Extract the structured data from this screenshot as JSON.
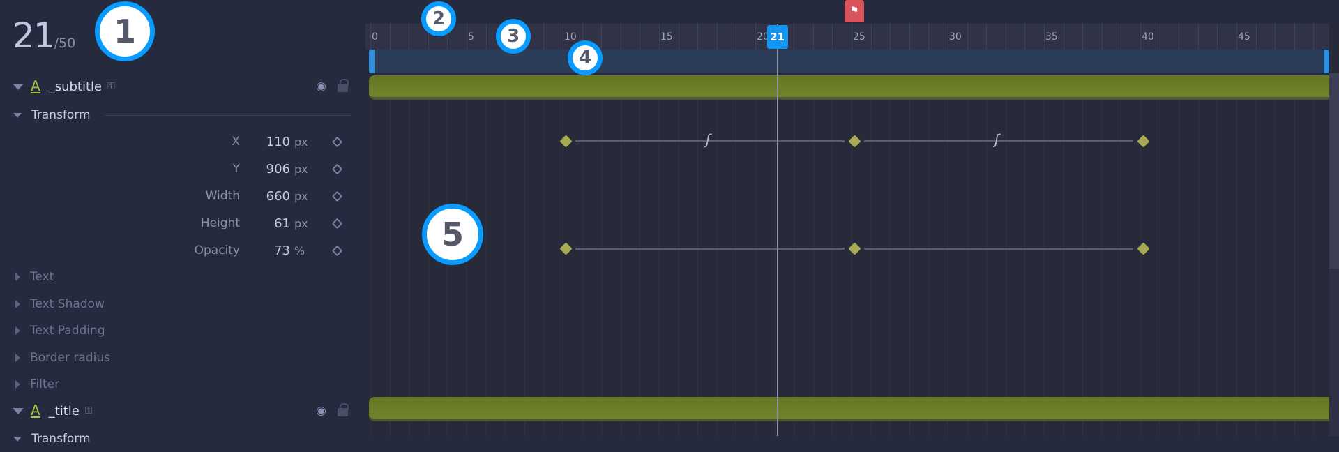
{
  "frame": {
    "current": "21",
    "total": "/50"
  },
  "layers": [
    {
      "name": "_subtitle",
      "icon": "text-layer-icon"
    },
    {
      "name": "_title",
      "icon": "text-layer-icon"
    }
  ],
  "transform": {
    "label": "Transform",
    "props": [
      {
        "label": "X",
        "value": "110",
        "unit": "px"
      },
      {
        "label": "Y",
        "value": "906",
        "unit": "px"
      },
      {
        "label": "Width",
        "value": "660",
        "unit": "px"
      },
      {
        "label": "Height",
        "value": "61",
        "unit": "px"
      },
      {
        "label": "Opacity",
        "value": "73",
        "unit": "%"
      }
    ]
  },
  "sections": [
    "Text",
    "Text Shadow",
    "Text Padding",
    "Border radius",
    "Filter"
  ],
  "next_section": "Transform",
  "timeline": {
    "total_frames": 50,
    "current_frame": 21,
    "playhead_label": "21",
    "marker_frame": 25,
    "tick_labels": [
      "0",
      "5",
      "10",
      "15",
      "20",
      "25",
      "30",
      "35",
      "40",
      "45"
    ],
    "keyframe_rows": [
      {
        "property": "X",
        "frames": [
          10,
          25,
          40
        ],
        "eased": true
      },
      {
        "property": "Opacity",
        "frames": [
          10,
          25,
          40
        ],
        "eased": false
      }
    ]
  },
  "callouts": [
    "1",
    "2",
    "3",
    "4",
    "5"
  ],
  "colors": {
    "accent": "#1296f2",
    "layer_bar": "#71832a",
    "keyframe": "#a7a953",
    "marker": "#d9535d"
  }
}
